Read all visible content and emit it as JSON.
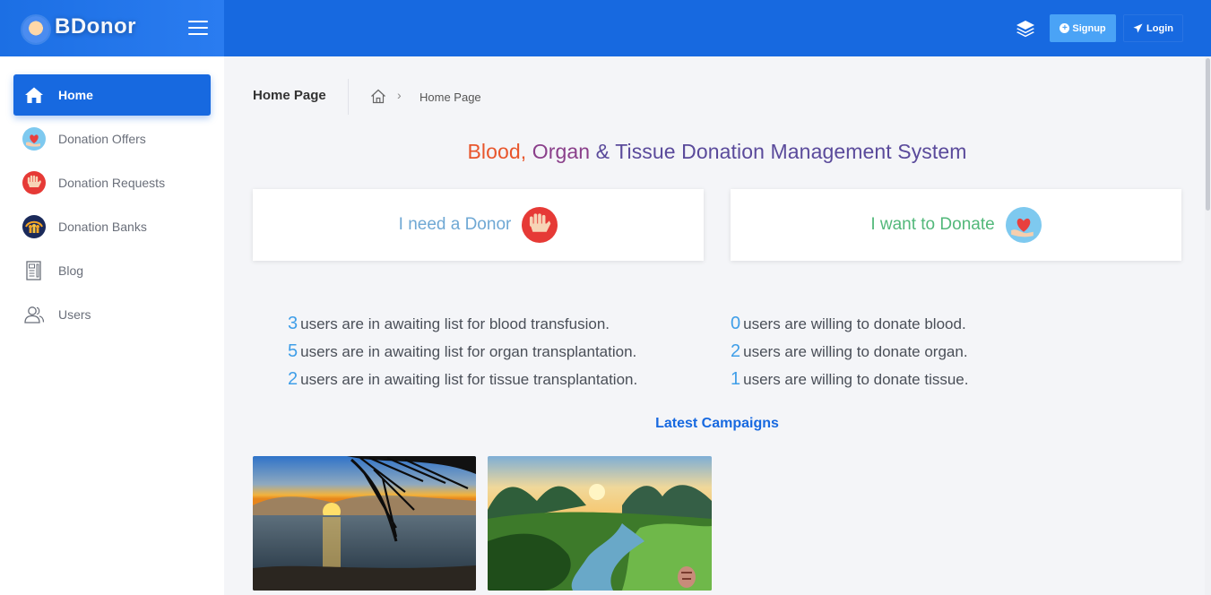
{
  "brand": {
    "name": "BDonor"
  },
  "topbar": {
    "signup_label": "Signup",
    "login_label": "Login"
  },
  "sidebar": {
    "items": [
      {
        "label": "Home",
        "icon": "home-icon",
        "active": true
      },
      {
        "label": "Donation Offers",
        "icon": "heart-hand-icon"
      },
      {
        "label": "Donation Requests",
        "icon": "raised-hand-icon"
      },
      {
        "label": "Donation Banks",
        "icon": "people-group-icon"
      },
      {
        "label": "Blog",
        "icon": "notebook-icon"
      },
      {
        "label": "Users",
        "icon": "users-icon"
      }
    ]
  },
  "breadcrumb": {
    "title": "Home Page",
    "current": "Home Page"
  },
  "main": {
    "title_parts": [
      "Blood, ",
      "Organ",
      " & Tissue Donation Management System"
    ],
    "card_need": "I need a Donor",
    "card_give": "I want to Donate",
    "stats_left": [
      {
        "num": "3",
        "text": "users are in awaiting list for blood transfusion."
      },
      {
        "num": "5",
        "text": "users are in awaiting list for organ transplantation."
      },
      {
        "num": "2",
        "text": "users are in awaiting list for tissue transplantation."
      }
    ],
    "stats_right": [
      {
        "num": "0",
        "text": "users are willing to donate blood."
      },
      {
        "num": "2",
        "text": "users are willing to donate organ."
      },
      {
        "num": "1",
        "text": "users are willing to donate tissue."
      }
    ],
    "campaigns_title": "Latest Campaigns"
  },
  "colors": {
    "primary": "#1769e0",
    "signup": "#4aa3f6",
    "accent_num": "#3f9ee8"
  }
}
